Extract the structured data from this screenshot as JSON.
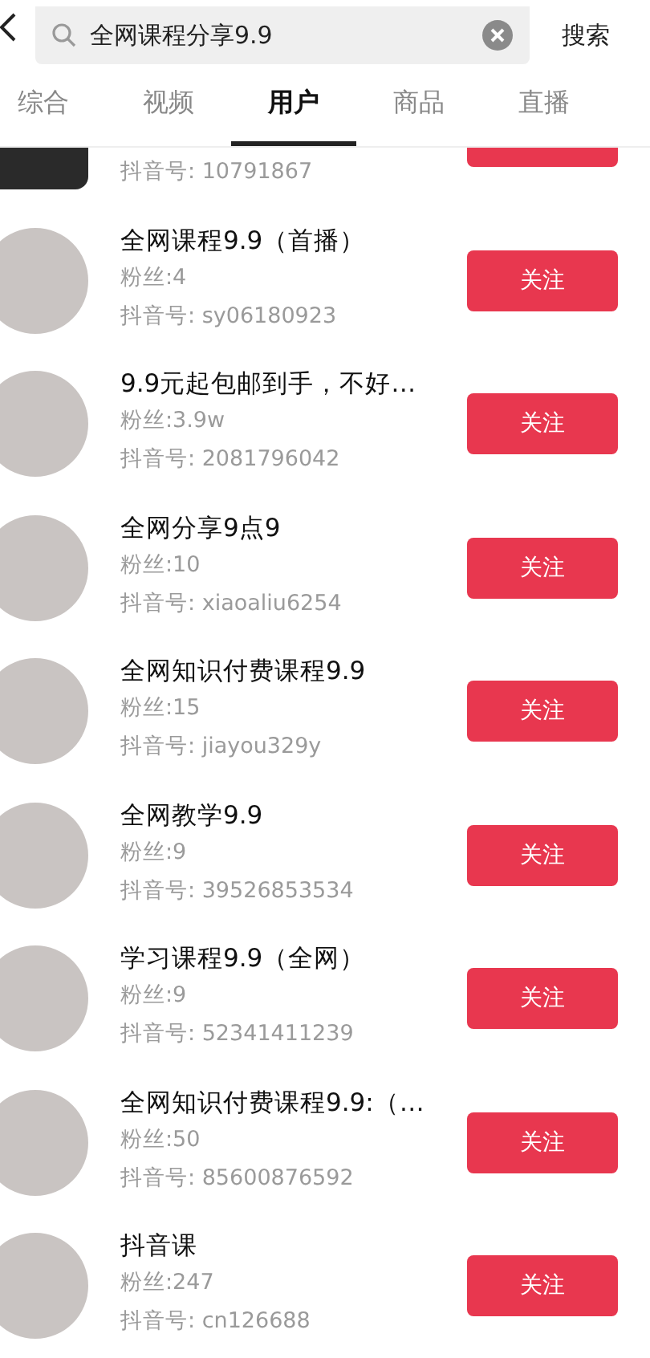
{
  "search": {
    "value": "全网课程分享9.9",
    "action": "搜索"
  },
  "tabs": [
    {
      "label": "综合",
      "selected": false
    },
    {
      "label": "视频",
      "selected": false
    },
    {
      "label": "用户",
      "selected": true
    },
    {
      "label": "商品",
      "selected": false
    },
    {
      "label": "直播",
      "selected": false
    }
  ],
  "partial_user": {
    "id": "抖音号: 10791867"
  },
  "users": [
    {
      "name": "全网课程9.9（首播）",
      "fans": "粉丝:4",
      "id": "抖音号: sy06180923",
      "button": "关注"
    },
    {
      "name": "9.9元起包邮到手，不好…",
      "fans": "粉丝:3.9w",
      "id": "抖音号: 2081796042",
      "button": "关注"
    },
    {
      "name": "全网分享9点9",
      "fans": "粉丝:10",
      "id": "抖音号: xiaoaliu6254",
      "button": "关注"
    },
    {
      "name": "全网知识付费课程9.9",
      "fans": "粉丝:15",
      "id": "抖音号: jiayou329y",
      "button": "关注"
    },
    {
      "name": "全网教学9.9",
      "fans": "粉丝:9",
      "id": "抖音号: 39526853534",
      "button": "关注"
    },
    {
      "name": "学习课程9.9（全网）",
      "fans": "粉丝:9",
      "id": "抖音号: 52341411239",
      "button": "关注"
    },
    {
      "name": "全网知识付费课程9.9:（…",
      "fans": "粉丝:50",
      "id": "抖音号: 85600876592",
      "button": "关注"
    },
    {
      "name": "抖音课",
      "fans": "粉丝:247",
      "id": "抖音号: cn126688",
      "button": "关注"
    }
  ]
}
